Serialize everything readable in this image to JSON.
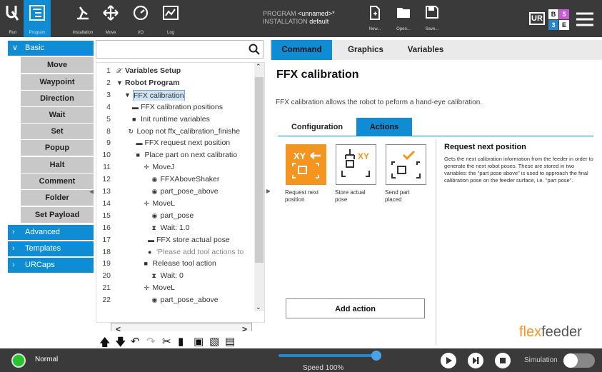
{
  "topbar": {
    "nav": [
      {
        "label": "Run"
      },
      {
        "label": "Program"
      },
      {
        "label": "Installation"
      },
      {
        "label": "Move"
      },
      {
        "label": "I/O"
      },
      {
        "label": "Log"
      }
    ],
    "program_key": "PROGRAM",
    "program_value": "<unnamed>*",
    "installation_key": "INSTALLATION",
    "installation_value": "default",
    "file_buttons": [
      {
        "label": "New..."
      },
      {
        "label": "Open..."
      },
      {
        "label": "Save..."
      }
    ],
    "badge_letters": [
      "B",
      "5",
      "3",
      "E"
    ]
  },
  "sidebar": {
    "basic_label": "Basic",
    "items": [
      "Move",
      "Waypoint",
      "Direction",
      "Wait",
      "Set",
      "Popup",
      "Halt",
      "Comment",
      "Folder",
      "Set Payload"
    ],
    "categories": [
      "Advanced",
      "Templates",
      "URCaps"
    ]
  },
  "tree": {
    "rows": [
      {
        "num": "1",
        "text": "Variables Setup"
      },
      {
        "num": "2",
        "text": "Robot Program"
      },
      {
        "num": "3",
        "text": "FFX calibration"
      },
      {
        "num": "4",
        "text": "FFX calibration positions"
      },
      {
        "num": "5",
        "text": "Init runtime variables"
      },
      {
        "num": "8",
        "text": "Loop not ffx_calibration_finishe"
      },
      {
        "num": "9",
        "text": "FFX request next position"
      },
      {
        "num": "10",
        "text": "Place part on next calibratio"
      },
      {
        "num": "11",
        "text": "MoveJ"
      },
      {
        "num": "12",
        "text": "FFXAboveShaker"
      },
      {
        "num": "13",
        "text": "part_pose_above"
      },
      {
        "num": "14",
        "text": "MoveL"
      },
      {
        "num": "15",
        "text": "part_pose"
      },
      {
        "num": "16",
        "text": "Wait: 1.0"
      },
      {
        "num": "17",
        "text": "FFX store actual pose"
      },
      {
        "num": "18",
        "text": "'Please add tool actions to"
      },
      {
        "num": "19",
        "text": "Release tool action"
      },
      {
        "num": "20",
        "text": "Wait: 0"
      },
      {
        "num": "21",
        "text": "MoveL"
      },
      {
        "num": "22",
        "text": "part_pose_above"
      }
    ]
  },
  "right": {
    "tabs": [
      "Command",
      "Graphics",
      "Variables"
    ],
    "title": "FFX calibration",
    "description": "FFX calibration allows the robot to peform a hand-eye calibration.",
    "subtabs": [
      "Configuration",
      "Actions"
    ],
    "actions": [
      {
        "label": "Request next position",
        "icon": "xy-arrow-icon"
      },
      {
        "label": "Store actual pose",
        "icon": "store-pose-icon"
      },
      {
        "label": "Send part placed",
        "icon": "check-target-icon"
      }
    ],
    "panel_title": "Request next position",
    "panel_desc": "Gets the next calibration information from the feeder in order to generate the next robot poses. These are stored in two variables: the \"part pose above\" is used to approach the final calibration pose on the feeder surface, i.e. \"part pose\".",
    "add_action": "Add action",
    "logo_a": "flex",
    "logo_b": "feeder"
  },
  "bottombar": {
    "status": "Normal",
    "speed": "Speed 100%",
    "speed_value": 1.0,
    "simulation": "Simulation"
  },
  "colors": {
    "accent": "#0f8cd4",
    "orange": "#f5951f",
    "dark": "#3a3a3a"
  }
}
